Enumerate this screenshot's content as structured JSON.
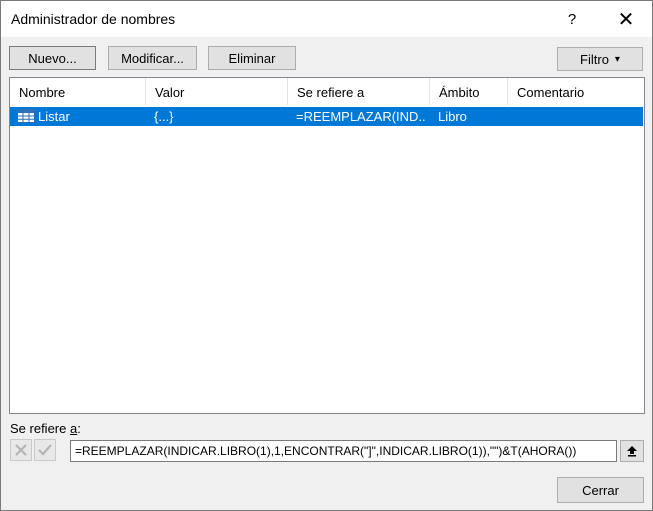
{
  "window": {
    "title": "Administrador de nombres",
    "help": "?",
    "close": "✕"
  },
  "toolbar": {
    "new_label": "Nuevo...",
    "edit_label": "Modificar...",
    "delete_label": "Eliminar",
    "filter_label": "Filtro",
    "filter_arrow": "▾"
  },
  "table": {
    "columns": [
      "Nombre",
      "Valor",
      "Se refiere a",
      "Ámbito",
      "Comentario"
    ],
    "rows": [
      {
        "name": "Listar",
        "value": "{...}",
        "refers_to": "=REEMPLAZAR(IND...",
        "scope": "Libro",
        "comment": "",
        "selected": true
      }
    ]
  },
  "refers_section": {
    "label_pre": "Se refiere ",
    "label_hotkey": "a",
    "label_post": ":",
    "formula": "=REEMPLAZAR(INDICAR.LIBRO(1),1,ENCONTRAR(\"]\",INDICAR.LIBRO(1)),\"\")&T(AHORA())"
  },
  "footer": {
    "close_label": "Cerrar"
  },
  "colors": {
    "selection": "#0078d7",
    "dialog_bg": "#f0f0f0",
    "button_bg": "#e1e1e1"
  }
}
